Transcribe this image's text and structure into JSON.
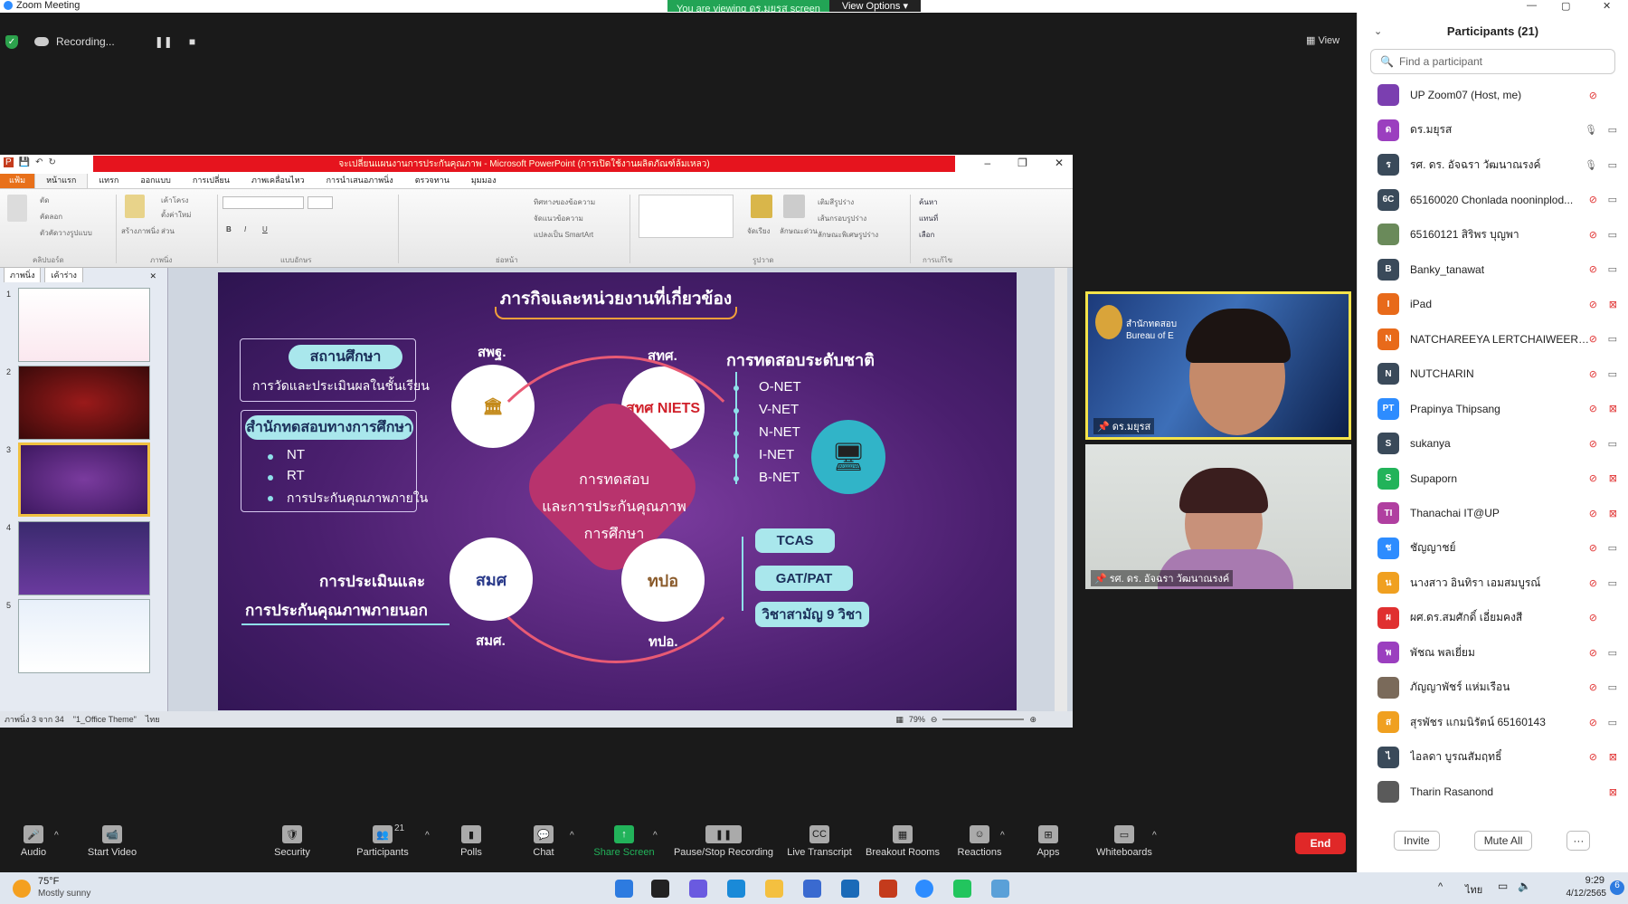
{
  "window": {
    "title": "Zoom Meeting",
    "min": "—",
    "max": "▢",
    "close": "✕"
  },
  "banner": {
    "viewing": "You are viewing ดร.มยุรส screen",
    "view_options": "View Options ▾"
  },
  "recording": {
    "label": "Recording...",
    "pause": "❚❚",
    "stop": "■"
  },
  "view_button": "View",
  "ppt": {
    "title": "จะเปลี่ยนแผนงานการประกันคุณภาพ - Microsoft PowerPoint (การเปิดใช้งานผลิตภัณฑ์ล้มเหลว)",
    "tabs": [
      "แฟ้ม",
      "หน้าแรก",
      "แทรก",
      "ออกแบบ",
      "การเปลี่ยน",
      "ภาพเคลื่อนไหว",
      "การนำเสนอภาพนิ่ง",
      "ตรวจทาน",
      "มุมมอง"
    ],
    "groups": [
      "คลิปบอร์ด",
      "ภาพนิ่ง",
      "แบบอักษร",
      "ย่อหน้า",
      "รูปวาด",
      "การแก้ไข"
    ],
    "ribbon_items": {
      "cut": "ตัด",
      "copy": "คัดลอก",
      "format_painter": "ตัวคัดวางรูปแบบ",
      "new_slide": "สร้างภาพนิ่ง",
      "layout": "เค้าโครง",
      "reset": "ตั้งค่าใหม่",
      "section": "ส่วน",
      "text_dir": "ทิศทางของข้อความ",
      "align_text": "จัดแนวข้อความ",
      "smartart": "แปลงเป็น SmartArt",
      "arrange": "จัดเรียง",
      "quick_styles": "ลักษณะด่วน",
      "shape_fill": "เติมสีรูปร่าง",
      "shape_outline": "เส้นกรอบรูปร่าง",
      "shape_effects": "ลักษณะพิเศษรูปร่าง",
      "find": "ค้นหา",
      "replace": "แทนที่",
      "select": "เลือก"
    },
    "panel_tabs": [
      "ภาพนิ่ง",
      "เค้าร่าง"
    ],
    "thumb_numbers": [
      "1",
      "2",
      "3",
      "4",
      "5"
    ],
    "status": {
      "slide": "ภาพนิ่ง 3 จาก 34",
      "theme": "\"1_Office Theme\"",
      "lang": "ไทย",
      "zoom": "79%"
    }
  },
  "slide": {
    "title": "ภารกิจและหน่วยงานที่เกี่ยวข้อง",
    "school_title": "สถานศึกษา",
    "school_sub": "การวัดและประเมินผลในชั้นเรียน",
    "office_title": "สำนักทดสอบทางการศึกษา",
    "office_items": [
      "NT",
      "RT",
      "การประกันคุณภาพภายใน"
    ],
    "obec": "สพฐ.",
    "niets": "สทศ.",
    "niets_logo": "สทศ NIETS",
    "onesqa": "สมศ.",
    "onesqa_logo": "สมศ",
    "tpo": "ทปอ.",
    "tpo_logo": "ทปอ",
    "center_text": [
      "การทดสอบ",
      "และการประกันคุณภาพ",
      "การศึกษา"
    ],
    "national_title": "การทดสอบระดับชาติ",
    "national_items": [
      "O-NET",
      "V-NET",
      "N-NET",
      "I-NET",
      "B-NET"
    ],
    "external": [
      "การประเมินและ",
      "การประกันคุณภาพภายนอก"
    ],
    "tcas": [
      "TCAS",
      "GAT/PAT",
      "วิชาสามัญ 9 วิชา"
    ]
  },
  "videos": {
    "v1_label": "ดร.มยุรส",
    "v1_bg_text": "สำนักทดสอบ Bureau of E",
    "v2_label": "รศ. ดร. อัจฉรา วัฒนาณรงค์"
  },
  "toolbar": [
    {
      "label": "Audio",
      "icon": "🎤"
    },
    {
      "label": "Start Video",
      "icon": "📹"
    },
    {
      "label": "Security",
      "icon": "🛡"
    },
    {
      "label": "Participants",
      "icon": "👥",
      "count": "21"
    },
    {
      "label": "Polls",
      "icon": "▮"
    },
    {
      "label": "Chat",
      "icon": "💬"
    },
    {
      "label": "Share Screen",
      "icon": "↑"
    },
    {
      "label": "Pause/Stop Recording",
      "icon": "❚❚"
    },
    {
      "label": "Live Transcript",
      "icon": "CC"
    },
    {
      "label": "Breakout Rooms",
      "icon": "▦"
    },
    {
      "label": "Reactions",
      "icon": "☺"
    },
    {
      "label": "Apps",
      "icon": "⊞"
    },
    {
      "label": "Whiteboards",
      "icon": "▭"
    }
  ],
  "end_label": "End",
  "participants": {
    "title": "Participants (21)",
    "search_placeholder": "Find a participant",
    "list": [
      {
        "name": "UP Zoom07 (Host, me)",
        "initial": "",
        "color": "#7b3fb0",
        "mic": "off",
        "cam": "none"
      },
      {
        "name": "ดร.มยุรส",
        "initial": "ด",
        "color": "#9b3fbf",
        "mic": "on",
        "cam": "on"
      },
      {
        "name": "รศ. ดร. อัจฉรา วัฒนาณรงค์",
        "initial": "ร",
        "color": "#3a4a5a",
        "mic": "on",
        "cam": "on"
      },
      {
        "name": "65160020 Chonlada nooninplod...",
        "initial": "6C",
        "color": "#3a4a5a",
        "mic": "off",
        "cam": "on"
      },
      {
        "name": "65160121 สิริพร บุญพา",
        "initial": "",
        "color": "#6a8a5a",
        "mic": "off",
        "cam": "on"
      },
      {
        "name": "Banky_tanawat",
        "initial": "B",
        "color": "#3a4a5a",
        "mic": "off",
        "cam": "on"
      },
      {
        "name": "iPad",
        "initial": "I",
        "color": "#e86a1a",
        "mic": "off",
        "cam": "off"
      },
      {
        "name": "NATCHAREEYA LERTCHAIWEERA...",
        "initial": "N",
        "color": "#e86a1a",
        "mic": "off",
        "cam": "on"
      },
      {
        "name": "NUTCHARIN",
        "initial": "N",
        "color": "#3a4a5a",
        "mic": "off",
        "cam": "on"
      },
      {
        "name": "Prapinya Thipsang",
        "initial": "PT",
        "color": "#2d8cff",
        "mic": "off",
        "cam": "off"
      },
      {
        "name": "sukanya",
        "initial": "S",
        "color": "#3a4a5a",
        "mic": "off",
        "cam": "on"
      },
      {
        "name": "Supaporn",
        "initial": "S",
        "color": "#22b35a",
        "mic": "off",
        "cam": "off"
      },
      {
        "name": "Thanachai IT@UP",
        "initial": "TI",
        "color": "#b03fa0",
        "mic": "off",
        "cam": "off"
      },
      {
        "name": "ชัญญาชย์",
        "initial": "ช",
        "color": "#2d8cff",
        "mic": "off",
        "cam": "on"
      },
      {
        "name": "นางสาว อินทิรา เอมสมบูรณ์",
        "initial": "น",
        "color": "#f0a020",
        "mic": "off",
        "cam": "on"
      },
      {
        "name": "ผศ.ดร.สมศักดิ์ เอี่ยมคงสี",
        "initial": "ผ",
        "color": "#e03030",
        "mic": "off",
        "cam": "none"
      },
      {
        "name": "พัชณ พลเยี่ยม",
        "initial": "พ",
        "color": "#9b3fbf",
        "mic": "off",
        "cam": "on"
      },
      {
        "name": "ภัญญาพัชร์ แห่มเรือน",
        "initial": "",
        "color": "#7a6a5a",
        "mic": "off",
        "cam": "on"
      },
      {
        "name": "สุรพัชร แกมนิรัตน์ 65160143",
        "initial": "ส",
        "color": "#f0a020",
        "mic": "off",
        "cam": "on"
      },
      {
        "name": "ไอลดา บูรณสัมฤทธิ์",
        "initial": "ไ",
        "color": "#3a4a5a",
        "mic": "off",
        "cam": "off"
      },
      {
        "name": "Tharin Rasanond",
        "initial": "",
        "color": "#5a5a5a",
        "mic": "none",
        "cam": "off"
      }
    ],
    "invite": "Invite",
    "mute_all": "Mute All",
    "more": "···"
  },
  "taskbar": {
    "temp": "75°F",
    "weather": "Mostly sunny",
    "lang": "ไทย",
    "time": "9:29",
    "date": "4/12/2565",
    "notif": "6"
  },
  "colors": {
    "zoom_blue": "#2d8cff",
    "end_red": "#e02828",
    "share_green": "#22b35a",
    "slide_purple": "#4a1f6e",
    "pill_cyan": "#a9e7ec"
  }
}
